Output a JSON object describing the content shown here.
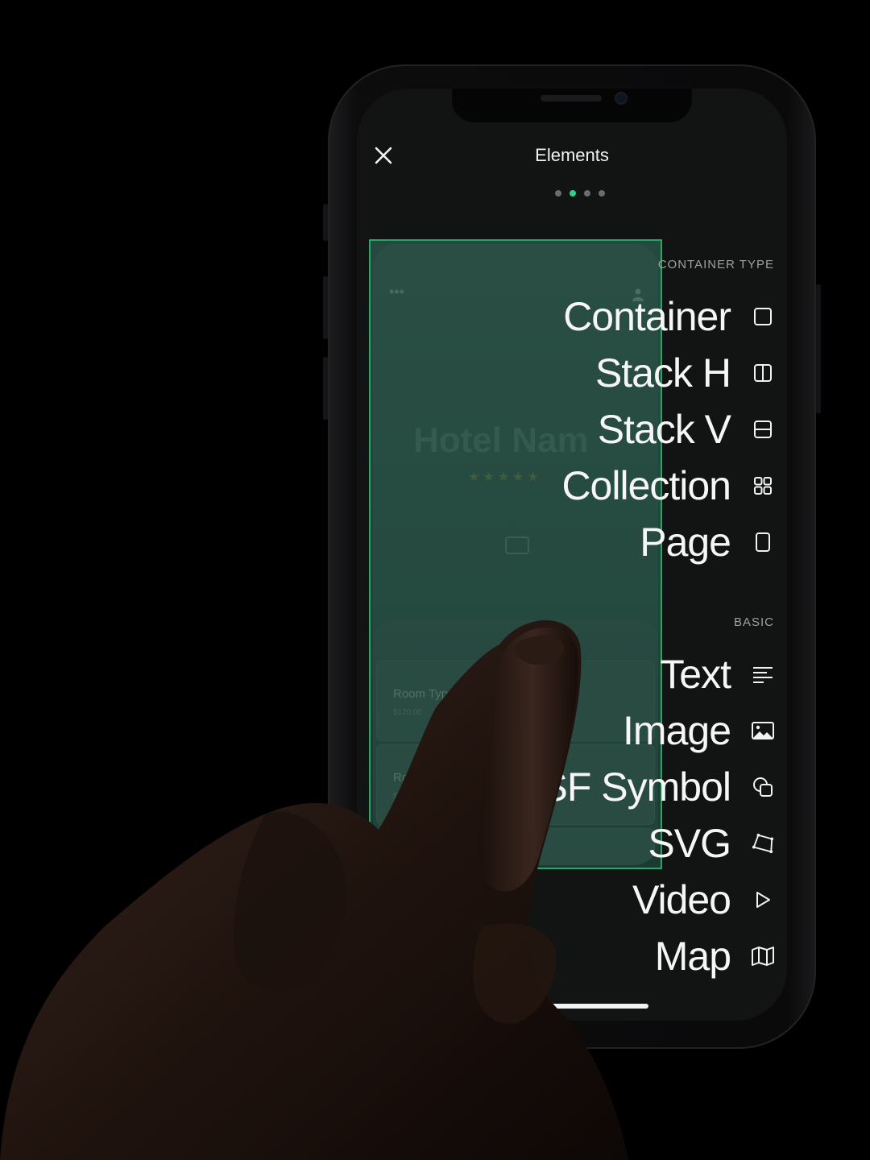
{
  "header": {
    "title": "Elements",
    "page_dots": {
      "count": 4,
      "active_index": 1
    }
  },
  "preview": {
    "hotel_name": "Hotel Nam",
    "room_rows": [
      {
        "title": "Room Type",
        "price": "$120.00"
      },
      {
        "title": "Room T",
        "price": "$120.00"
      },
      {
        "title": "Ro"
      }
    ]
  },
  "container_section": {
    "label": "CONTAINER TYPE",
    "items": [
      {
        "label": "Container",
        "icon": "square-icon"
      },
      {
        "label": "Stack H",
        "icon": "stack-horizontal-icon"
      },
      {
        "label": "Stack V",
        "icon": "stack-vertical-icon"
      },
      {
        "label": "Collection",
        "icon": "grid-icon"
      },
      {
        "label": "Page",
        "icon": "page-icon"
      }
    ]
  },
  "basic_section": {
    "label": "BASIC",
    "items": [
      {
        "label": "Text",
        "icon": "text-lines-icon"
      },
      {
        "label": "Image",
        "icon": "image-icon"
      },
      {
        "label": "SF Symbol",
        "icon": "sf-symbol-icon"
      },
      {
        "label": "SVG",
        "icon": "svg-path-icon"
      },
      {
        "label": "Video",
        "icon": "play-icon"
      },
      {
        "label": "Map",
        "icon": "map-icon"
      }
    ]
  },
  "colors": {
    "accent": "#2fd18a",
    "selection_border": "#23a86a",
    "screen_bg": "#121313",
    "text": "#f6f6f6"
  }
}
